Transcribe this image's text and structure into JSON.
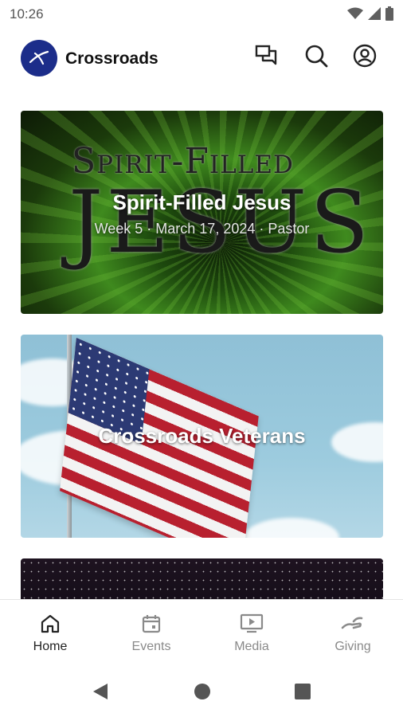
{
  "status_bar": {
    "time": "10:26",
    "icons": [
      "wifi-icon",
      "signal-icon",
      "battery-icon"
    ]
  },
  "app_bar": {
    "title": "Crossroads",
    "logo_icon": "crossroads-logo-icon",
    "actions": [
      "chat-icon",
      "search-icon",
      "account-icon"
    ]
  },
  "feed": {
    "cards": [
      {
        "title": "Spirit-Filled Jesus",
        "subtitle": "Week 5 · March 17, 2024 · Pastor",
        "artwork_text_top": "Spirit-Filled",
        "artwork_text_big": "JESUS"
      },
      {
        "title": "Crossroads Veterans"
      },
      {
        "title": ""
      }
    ]
  },
  "bottom_nav": {
    "items": [
      {
        "label": "Home",
        "icon": "home-icon",
        "active": true
      },
      {
        "label": "Events",
        "icon": "calendar-icon",
        "active": false
      },
      {
        "label": "Media",
        "icon": "media-play-icon",
        "active": false
      },
      {
        "label": "Giving",
        "icon": "giving-hand-icon",
        "active": false
      }
    ]
  },
  "system_nav": {
    "buttons": [
      "back-icon",
      "home-circle-icon",
      "recents-icon"
    ]
  },
  "colors": {
    "brand": "#1c2d8a",
    "nav_active": "#222222",
    "nav_inactive": "#8a8a8a"
  }
}
